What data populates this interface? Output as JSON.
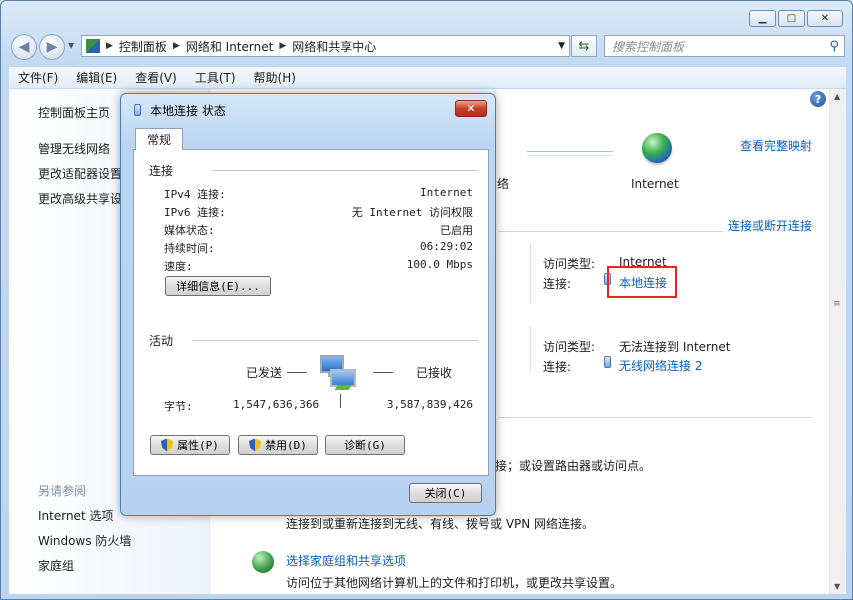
{
  "window": {
    "caption_buttons": {
      "minimize": "▁",
      "maximize": "□",
      "close": "✕"
    }
  },
  "address_bar": {
    "crumbs": [
      "控制面板",
      "网络和 Internet",
      "网络和共享中心"
    ],
    "search_placeholder": "搜索控制面板"
  },
  "menu": [
    "文件(F)",
    "编辑(E)",
    "查看(V)",
    "工具(T)",
    "帮助(H)"
  ],
  "sidebar": {
    "home": "控制面板主页",
    "tasks": [
      "管理无线网络",
      "更改适配器设置",
      "更改高级共享设置"
    ],
    "see_also_header": "另请参阅",
    "see_also": [
      "Internet 选项",
      "Windows 防火墙",
      "家庭组"
    ]
  },
  "main": {
    "view_full_map": "查看完整映射",
    "network_partial": "络",
    "internet_label": "Internet",
    "connect_disconnect": "连接或断开连接",
    "net1": {
      "access_type_label": "访问类型:",
      "access_type_value": "Internet",
      "connection_label": "连接:",
      "connection_value": "本地连接"
    },
    "net2": {
      "access_type_label": "访问类型:",
      "access_type_value": "无法连接到 Internet",
      "connection_label": "连接:",
      "connection_value": "无线网络连接 2"
    },
    "partial_text_1": "接；或设置路由器或访问点。",
    "partial_text_2": "连接到或重新连接到无线、有线、拨号或 VPN 网络连接。",
    "homegroup_link": "选择家庭组和共享选项",
    "homegroup_desc": "访问位于其他网络计算机上的文件和打印机，或更改共享设置。"
  },
  "dialog": {
    "title": "本地连接 状态",
    "tab": "常规",
    "connection_group": "连接",
    "rows": [
      {
        "label": "IPv4 连接:",
        "value": "Internet"
      },
      {
        "label": "IPv6 连接:",
        "value": "无 Internet 访问权限"
      },
      {
        "label": "媒体状态:",
        "value": "已启用"
      },
      {
        "label": "持续时间:",
        "value": "06:29:02"
      },
      {
        "label": "速度:",
        "value": "100.0 Mbps"
      }
    ],
    "details_button": "详细信息(E)...",
    "activity_group": "活动",
    "sent_label": "已发送",
    "received_label": "已接收",
    "bytes_label": "字节:",
    "bytes_sent": "1,547,636,366",
    "bytes_received": "3,587,839,426",
    "properties_button": "属性(P)",
    "disable_button": "禁用(D)",
    "diagnose_button": "诊断(G)",
    "close_button": "关闭(C)"
  }
}
